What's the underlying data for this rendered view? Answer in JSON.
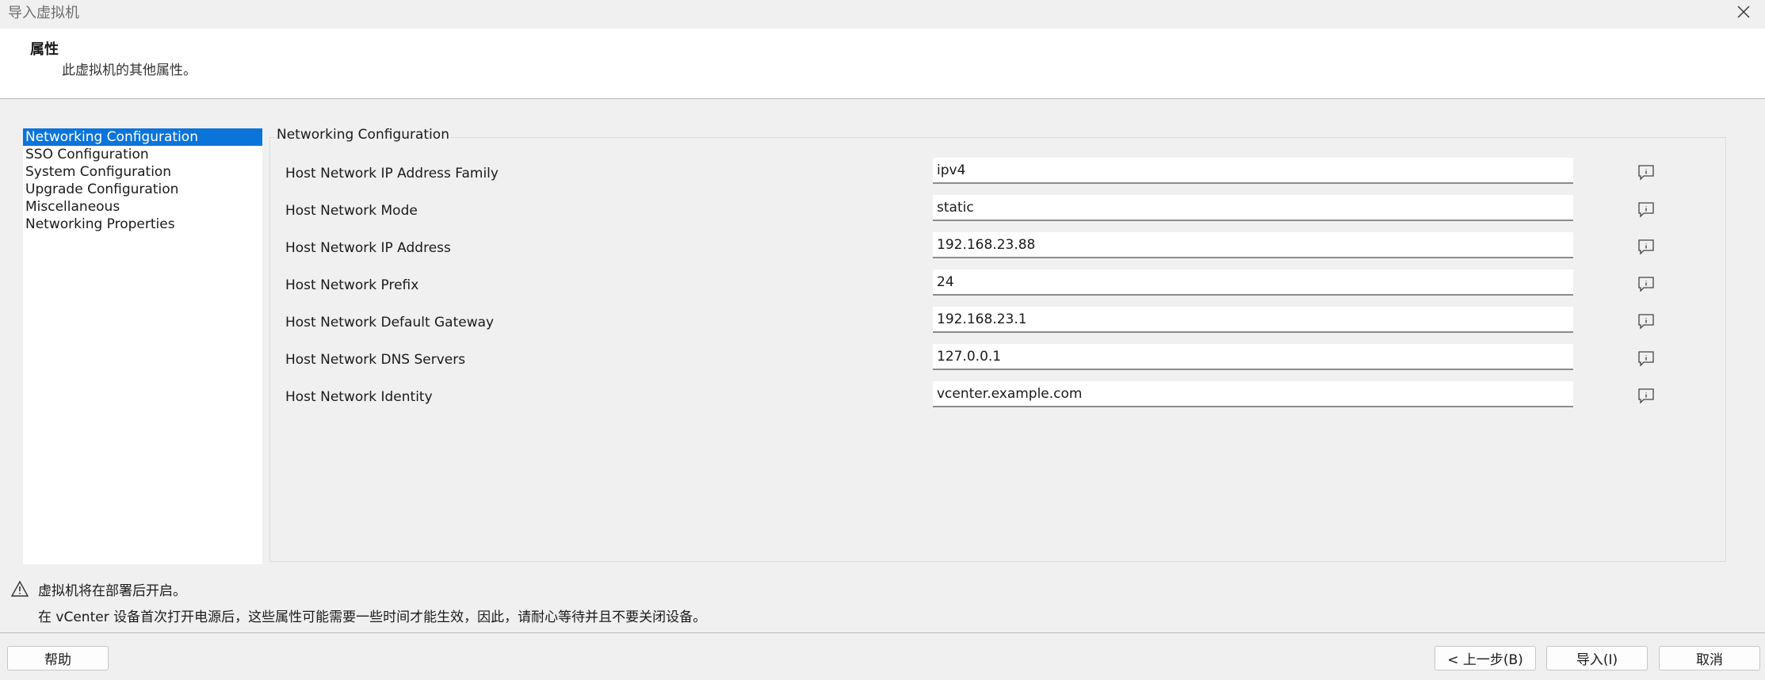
{
  "window": {
    "title": "导入虚拟机",
    "close_icon": "close-icon"
  },
  "header": {
    "title": "属性",
    "subtitle": "此虚拟机的其他属性。"
  },
  "sidebar": {
    "items": [
      {
        "label": "Networking Configuration",
        "selected": true
      },
      {
        "label": "SSO Configuration",
        "selected": false
      },
      {
        "label": "System Configuration",
        "selected": false
      },
      {
        "label": "Upgrade Configuration",
        "selected": false
      },
      {
        "label": "Miscellaneous",
        "selected": false
      },
      {
        "label": "Networking Properties",
        "selected": false
      }
    ]
  },
  "main": {
    "group_title": "Networking Configuration",
    "fields": [
      {
        "label": "Host Network IP Address Family",
        "value": "ipv4"
      },
      {
        "label": "Host Network Mode",
        "value": "static"
      },
      {
        "label": "Host Network IP Address",
        "value": "192.168.23.88"
      },
      {
        "label": "Host Network Prefix",
        "value": "24"
      },
      {
        "label": "Host Network Default Gateway",
        "value": "192.168.23.1"
      },
      {
        "label": "Host Network DNS Servers",
        "value": "127.0.0.1"
      },
      {
        "label": "Host Network Identity",
        "value": "vcenter.example.com"
      }
    ],
    "info_icon": "info-comment-icon"
  },
  "footer": {
    "warning_icon": "warning-icon",
    "message_1": "虚拟机将在部署后开启。",
    "message_2": "在 vCenter 设备首次打开电源后，这些属性可能需要一些时间才能生效，因此，请耐心等待并且不要关闭设备。",
    "help_label": "帮助",
    "back_label": "< 上一步(B)",
    "import_label": "导入(I)",
    "cancel_label": "取消"
  },
  "colors": {
    "selection": "#0a74da",
    "background": "#f0f0f0"
  }
}
